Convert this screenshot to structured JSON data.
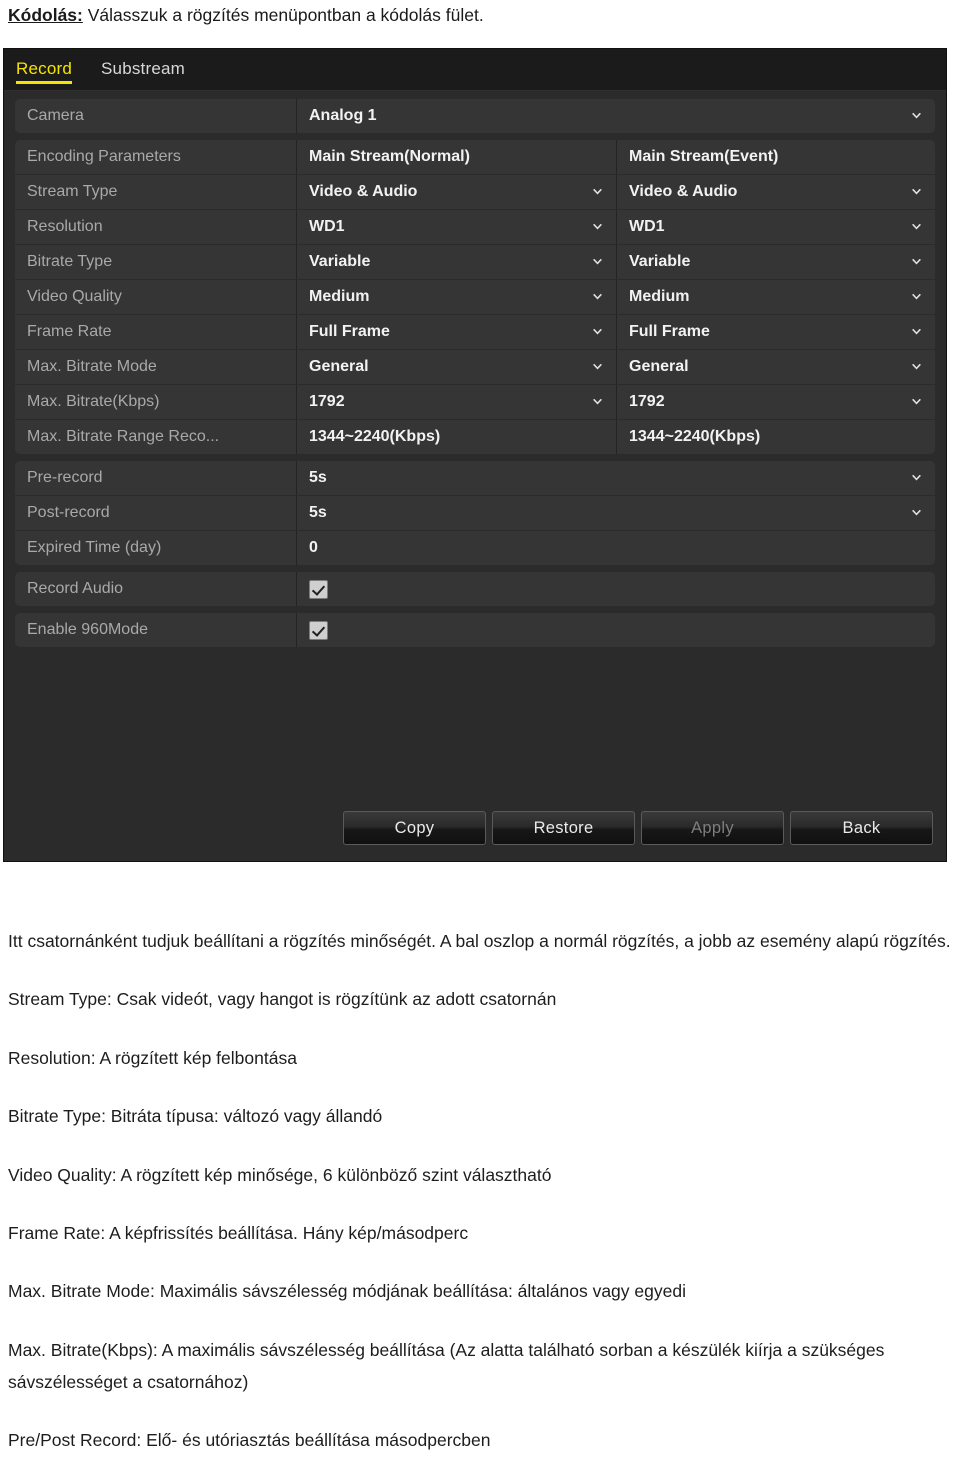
{
  "document": {
    "heading_lead": "Kódolás:",
    "heading_rest": " Válasszuk a rögzítés menüpontban a kódolás fület.",
    "paragraphs": [
      "Itt csatornánként tudjuk beállítani a rögzítés minőségét. A bal oszlop a normál rögzítés, a jobb az esemény alapú rögzítés.",
      "Stream Type: Csak videót, vagy hangot is rögzítünk az adott csatornán",
      "Resolution: A rögzített kép felbontása",
      "Bitrate Type: Bitráta típusa: változó vagy állandó",
      "Video Quality: A rögzített kép minősége, 6 különböző szint választható",
      "Frame Rate: A képfrissítés beállítása. Hány kép/másodperc",
      "Max. Bitrate Mode: Maximális sávszélesség módjának beállítása: általános vagy egyedi",
      "Max. Bitrate(Kbps): A maximális sávszélesség beállítása (Az alatta található sorban a készülék kiírja a szükséges sávszélességet a csatornához)",
      "Pre/Post Record: Elő- és utóriasztás beállítása másodpercben"
    ]
  },
  "dvr": {
    "tabs": [
      {
        "label": "Record",
        "active": true
      },
      {
        "label": "Substream",
        "active": false
      }
    ],
    "colors": {
      "active_tab": "#f5e400",
      "panel_bg": "#2b2b2b",
      "row_bg": "#353535",
      "label_text": "#a9a9a9",
      "value_text": "#f2f2f2"
    },
    "groups": [
      {
        "rows": [
          {
            "label": "Camera",
            "type": "single",
            "value": "Analog 1",
            "dropdown": true
          }
        ]
      },
      {
        "rows": [
          {
            "label": "Encoding Parameters",
            "type": "dual",
            "left": {
              "value": "Main Stream(Normal)",
              "dropdown": false
            },
            "right": {
              "value": "Main Stream(Event)",
              "dropdown": false
            }
          },
          {
            "label": "Stream Type",
            "type": "dual",
            "left": {
              "value": "Video & Audio",
              "dropdown": true
            },
            "right": {
              "value": "Video & Audio",
              "dropdown": true
            }
          },
          {
            "label": "Resolution",
            "type": "dual",
            "left": {
              "value": "WD1",
              "dropdown": true
            },
            "right": {
              "value": "WD1",
              "dropdown": true
            }
          },
          {
            "label": "Bitrate Type",
            "type": "dual",
            "left": {
              "value": "Variable",
              "dropdown": true
            },
            "right": {
              "value": "Variable",
              "dropdown": true
            }
          },
          {
            "label": "Video Quality",
            "type": "dual",
            "left": {
              "value": "Medium",
              "dropdown": true
            },
            "right": {
              "value": "Medium",
              "dropdown": true
            }
          },
          {
            "label": "Frame Rate",
            "type": "dual",
            "left": {
              "value": "Full Frame",
              "dropdown": true
            },
            "right": {
              "value": "Full Frame",
              "dropdown": true
            }
          },
          {
            "label": "Max. Bitrate Mode",
            "type": "dual",
            "left": {
              "value": "General",
              "dropdown": true
            },
            "right": {
              "value": "General",
              "dropdown": true
            }
          },
          {
            "label": "Max. Bitrate(Kbps)",
            "type": "dual",
            "left": {
              "value": "1792",
              "dropdown": true
            },
            "right": {
              "value": "1792",
              "dropdown": true
            }
          },
          {
            "label": "Max. Bitrate Range Reco...",
            "type": "dual",
            "left": {
              "value": "1344~2240(Kbps)",
              "dropdown": false
            },
            "right": {
              "value": "1344~2240(Kbps)",
              "dropdown": false
            }
          }
        ]
      },
      {
        "rows": [
          {
            "label": "Pre-record",
            "type": "single",
            "value": "5s",
            "dropdown": true
          },
          {
            "label": "Post-record",
            "type": "single",
            "value": "5s",
            "dropdown": true
          },
          {
            "label": "Expired Time (day)",
            "type": "single",
            "value": "0",
            "dropdown": false
          }
        ]
      },
      {
        "rows": [
          {
            "label": "Record Audio",
            "type": "checkbox",
            "checked": true
          }
        ]
      },
      {
        "rows": [
          {
            "label": "Enable 960Mode",
            "type": "checkbox",
            "checked": true
          }
        ]
      }
    ],
    "buttons": [
      {
        "label": "Copy",
        "disabled": false
      },
      {
        "label": "Restore",
        "disabled": false
      },
      {
        "label": "Apply",
        "disabled": true
      },
      {
        "label": "Back",
        "disabled": false
      }
    ]
  }
}
